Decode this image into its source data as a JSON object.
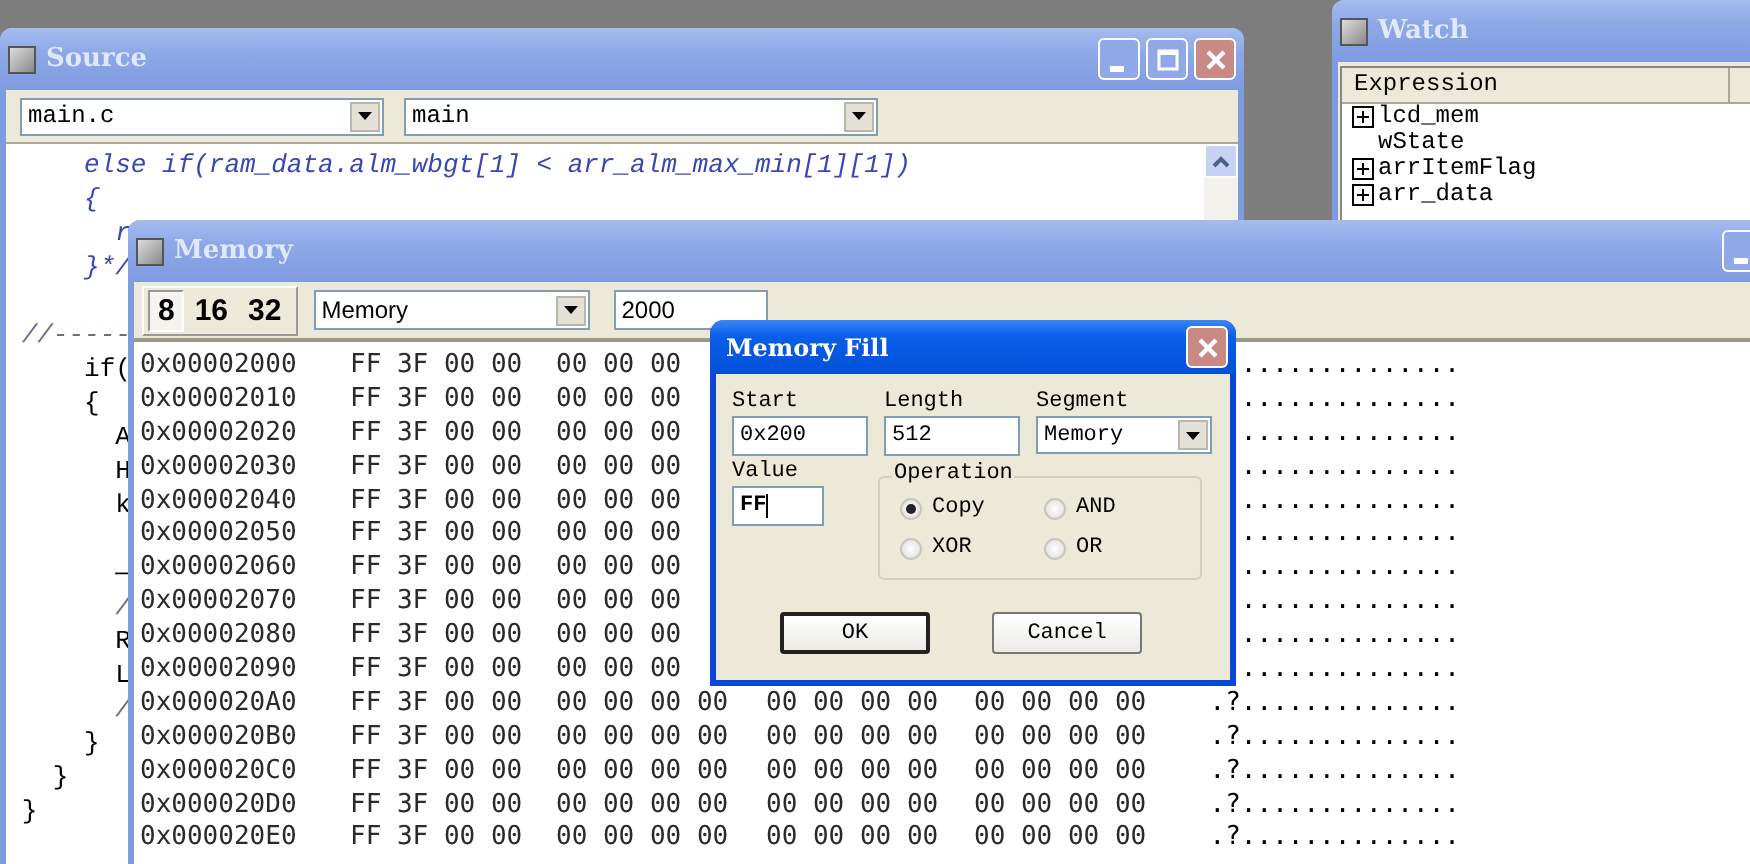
{
  "source_window": {
    "title": "Source",
    "file_combo": "main.c",
    "function_combo": "main",
    "lines": [
      {
        "kind": "comment",
        "text": "     else if(ram_data.alm_wbgt[1] < arr_alm_max_min[1][1])"
      },
      {
        "kind": "comment",
        "text": "     {"
      },
      {
        "kind": "comment",
        "text": "       r"
      },
      {
        "kind": "comment",
        "text": "     }*/"
      },
      {
        "kind": "blank"
      },
      {
        "kind": "line-comment",
        "text": " //-----"
      },
      {
        "kind": "code",
        "text": "     if("
      },
      {
        "kind": "code",
        "text": "     {"
      },
      {
        "kind": "code",
        "text": "       A"
      },
      {
        "kind": "code",
        "text": "       H"
      },
      {
        "kind": "code",
        "text": "       k"
      },
      {
        "kind": "blank"
      },
      {
        "kind": "code",
        "text": "       —"
      },
      {
        "kind": "line-comment",
        "text": "       /"
      },
      {
        "kind": "code",
        "text": "       R"
      },
      {
        "kind": "code",
        "text": "       L"
      },
      {
        "kind": "line-comment",
        "text": "       /"
      },
      {
        "kind": "code",
        "text": "     }"
      },
      {
        "kind": "code",
        "text": "   }"
      },
      {
        "kind": "code",
        "text": " }"
      }
    ]
  },
  "watch_window": {
    "title": "Watch",
    "column_1": "Expression",
    "items": [
      {
        "name": "lcd_mem",
        "expandable": true
      },
      {
        "name": "wState",
        "expandable": false
      },
      {
        "name": "arrItemFlag",
        "expandable": true
      },
      {
        "name": "arr_data",
        "expandable": true
      }
    ]
  },
  "memory_window": {
    "title": "Memory",
    "width_buttons": [
      {
        "label": "8",
        "selected": true
      },
      {
        "label": "16",
        "selected": false
      },
      {
        "label": "32",
        "selected": false
      }
    ],
    "segment": "Memory",
    "address": "2000",
    "rows": [
      {
        "address": "0x00002000",
        "groups": [
          "FF 3F 00 00",
          "00 00 00"
        ],
        "ascii": ".............."
      },
      {
        "address": "0x00002010",
        "groups": [
          "FF 3F 00 00",
          "00 00 00"
        ],
        "ascii": ".............."
      },
      {
        "address": "0x00002020",
        "groups": [
          "FF 3F 00 00",
          "00 00 00"
        ],
        "ascii": ".............."
      },
      {
        "address": "0x00002030",
        "groups": [
          "FF 3F 00 00",
          "00 00 00"
        ],
        "ascii": ".............."
      },
      {
        "address": "0x00002040",
        "groups": [
          "FF 3F 00 00",
          "00 00 00"
        ],
        "ascii": ".............."
      },
      {
        "address": "0x00002050",
        "groups": [
          "FF 3F 00 00",
          "00 00 00"
        ],
        "ascii": ".............."
      },
      {
        "address": "0x00002060",
        "groups": [
          "FF 3F 00 00",
          "00 00 00"
        ],
        "ascii": ".............."
      },
      {
        "address": "0x00002070",
        "groups": [
          "FF 3F 00 00",
          "00 00 00"
        ],
        "ascii": ".............."
      },
      {
        "address": "0x00002080",
        "groups": [
          "FF 3F 00 00",
          "00 00 00"
        ],
        "ascii": ".............."
      },
      {
        "address": "0x00002090",
        "groups": [
          "FF 3F 00 00",
          "00 00 00"
        ],
        "ascii": ".............."
      },
      {
        "address": "0x000020A0",
        "groups": [
          "FF 3F 00 00",
          "00 00 00 00",
          "00 00 00 00",
          "00 00 00 00"
        ],
        "ascii": ".?.............."
      },
      {
        "address": "0x000020B0",
        "groups": [
          "FF 3F 00 00",
          "00 00 00 00",
          "00 00 00 00",
          "00 00 00 00"
        ],
        "ascii": ".?.............."
      },
      {
        "address": "0x000020C0",
        "groups": [
          "FF 3F 00 00",
          "00 00 00 00",
          "00 00 00 00",
          "00 00 00 00"
        ],
        "ascii": ".?.............."
      },
      {
        "address": "0x000020D0",
        "groups": [
          "FF 3F 00 00",
          "00 00 00 00",
          "00 00 00 00",
          "00 00 00 00"
        ],
        "ascii": ".?.............."
      },
      {
        "address": "0x000020E0",
        "groups": [
          "FF 3F 00 00",
          "00 00 00 00",
          "00 00 00 00",
          "00 00 00 00"
        ],
        "ascii": ".?.............."
      }
    ]
  },
  "dialog": {
    "title": "Memory Fill",
    "start_label": "Start",
    "start": "0x200",
    "length_label": "Length",
    "length": "512",
    "segment_label": "Segment",
    "segment": "Memory",
    "value_label": "Value",
    "value": "FF",
    "operation_label": "Operation",
    "operations": [
      {
        "label": "Copy",
        "selected": true
      },
      {
        "label": "AND",
        "selected": false
      },
      {
        "label": "XOR",
        "selected": false
      },
      {
        "label": "OR",
        "selected": false
      }
    ],
    "buttons": [
      {
        "label": "OK",
        "default": true
      },
      {
        "label": "Cancel",
        "default": false
      }
    ]
  }
}
